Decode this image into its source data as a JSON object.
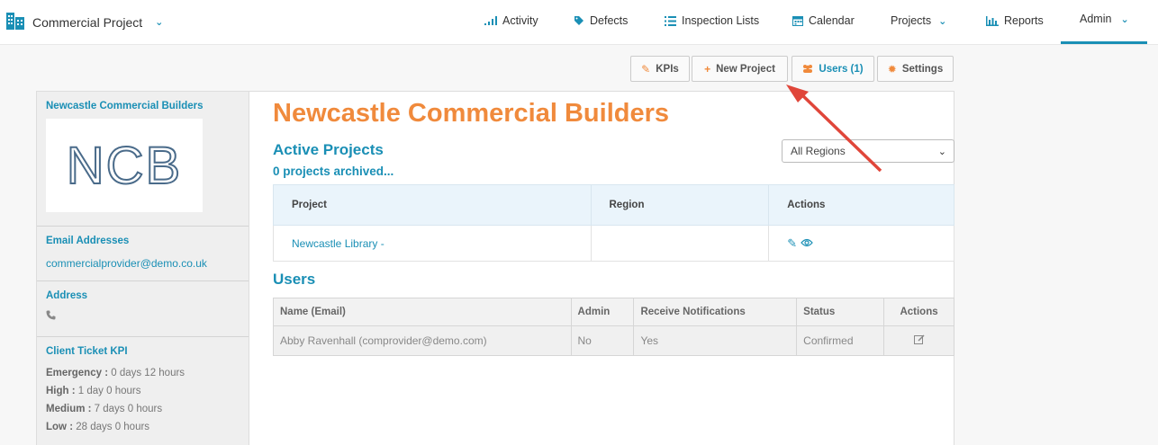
{
  "brand": {
    "name": "Commercial Project"
  },
  "nav": {
    "activity": "Activity",
    "defects": "Defects",
    "inspection_lists": "Inspection Lists",
    "calendar": "Calendar",
    "projects": "Projects",
    "reports": "Reports",
    "admin": "Admin"
  },
  "toolbar": {
    "kpis": "KPIs",
    "new_project": "New Project",
    "users": "Users (1)",
    "settings": "Settings"
  },
  "sidebar": {
    "company_name": "Newcastle Commercial Builders",
    "logo_text": "NCB",
    "email_title": "Email Addresses",
    "email": "commercialprovider@demo.co.uk",
    "address_title": "Address",
    "kpi_title": "Client Ticket KPI",
    "kpis": [
      {
        "label": "Emergency :",
        "value": " 0 days 12 hours"
      },
      {
        "label": "High :",
        "value": " 1 day 0 hours"
      },
      {
        "label": "Medium :",
        "value": " 7 days 0 hours"
      },
      {
        "label": "Low :",
        "value": " 28 days 0 hours"
      }
    ]
  },
  "main": {
    "title": "Newcastle Commercial Builders",
    "active_projects": "Active Projects",
    "archived": "0 projects archived...",
    "region_filter": "All Regions",
    "projects_table": {
      "headers": [
        "Project",
        "Region",
        "Actions"
      ],
      "rows": [
        {
          "project": "Newcastle Library -",
          "region": ""
        }
      ]
    },
    "users_title": "Users",
    "users_table": {
      "headers": [
        "Name (Email)",
        "Admin",
        "Receive Notifications",
        "Status",
        "Actions"
      ],
      "rows": [
        {
          "name": "Abby Ravenhall (comprovider@demo.com)",
          "admin": "No",
          "notifications": "Yes",
          "status": "Confirmed"
        }
      ]
    }
  },
  "colors": {
    "accent": "#1a8fb5",
    "title_orange": "#f08a3c",
    "annotation_red": "#e0463a"
  }
}
